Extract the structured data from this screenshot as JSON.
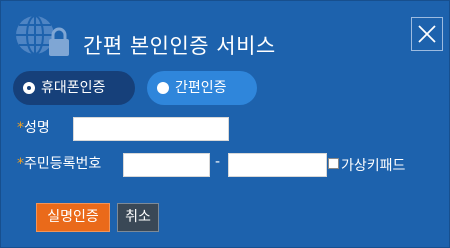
{
  "header": {
    "title": "간편 본인인증 서비스",
    "logo_icon": "globe-lock-icon",
    "close_icon": "close-icon"
  },
  "tabs": [
    {
      "label": "휴대폰인증",
      "selected": true
    },
    {
      "label": "간편인증",
      "selected": false
    }
  ],
  "form": {
    "required_mark": "*",
    "name_label": "성명",
    "name_value": "",
    "rrn_label": "주민등록번호",
    "rrn_front_value": "",
    "rrn_back_value": "",
    "rrn_separator": "-",
    "virtual_keypad_label": "가상키패드",
    "virtual_keypad_checked": false
  },
  "buttons": {
    "verify_label": "실명인증",
    "cancel_label": "취소"
  },
  "colors": {
    "panel_background": "#1d62ad",
    "selected_tab": "#16407a",
    "unselected_tab": "#2f86db",
    "required_mark": "#f2a11f",
    "verify_button": "#ea6a1a",
    "cancel_button": "#3a4856"
  }
}
